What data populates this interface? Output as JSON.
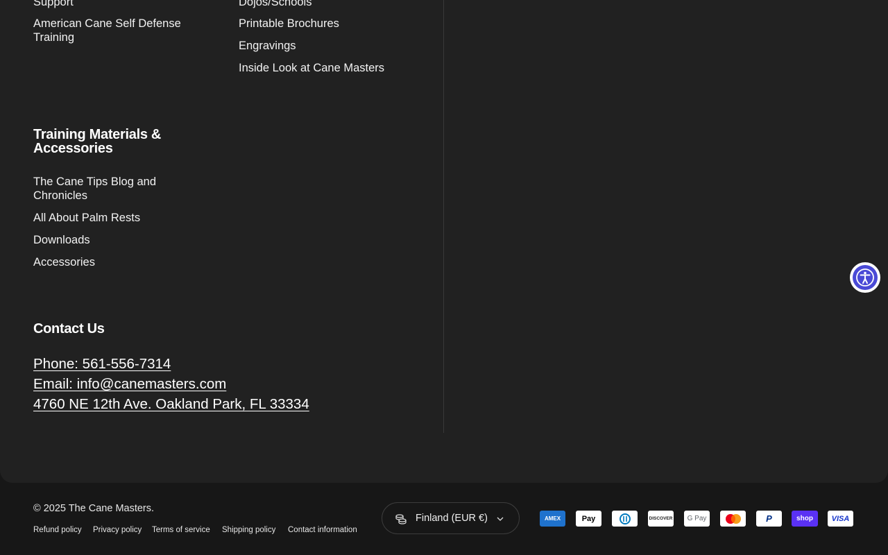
{
  "footer": {
    "col1_links": [
      "Support",
      "American Cane Self Defense Training"
    ],
    "col2_links": [
      "Dojos/Schools",
      "Printable Brochures",
      "Engravings",
      "Inside Look at Cane Masters"
    ],
    "training": {
      "heading": "Training Materials & Accessories",
      "links": [
        "The Cane Tips Blog and Chronicles",
        "All About Palm Rests",
        "Downloads",
        "Accessories"
      ]
    },
    "contact": {
      "heading": "Contact Us",
      "phone": "Phone: 561-556-7314",
      "email": "Email: info@canemasters.com",
      "address": "4760 NE 12th Ave. Oakland Park, FL 33334"
    }
  },
  "bottom": {
    "copyright": "© 2025 The Cane Masters.",
    "policies": [
      "Refund policy",
      "Privacy policy",
      "Terms of service",
      "Shipping policy",
      "Contact information"
    ],
    "country_selector": "Finland (EUR €)",
    "payment_icons": [
      "american-express",
      "apple-pay",
      "diners-club",
      "discover",
      "google-pay",
      "mastercard",
      "paypal",
      "shop-pay",
      "visa"
    ],
    "payment_labels": {
      "amex": "AMEX",
      "applepay": " Pay",
      "discover": "DISCOVER",
      "gpay": "G Pay",
      "paypal": "PayPal",
      "shop": "shop",
      "visa": "VISA"
    }
  },
  "colors": {
    "footer_bg": "#212121",
    "bottom_bg": "#171717",
    "a11y_accent": "#4a4ad6"
  }
}
